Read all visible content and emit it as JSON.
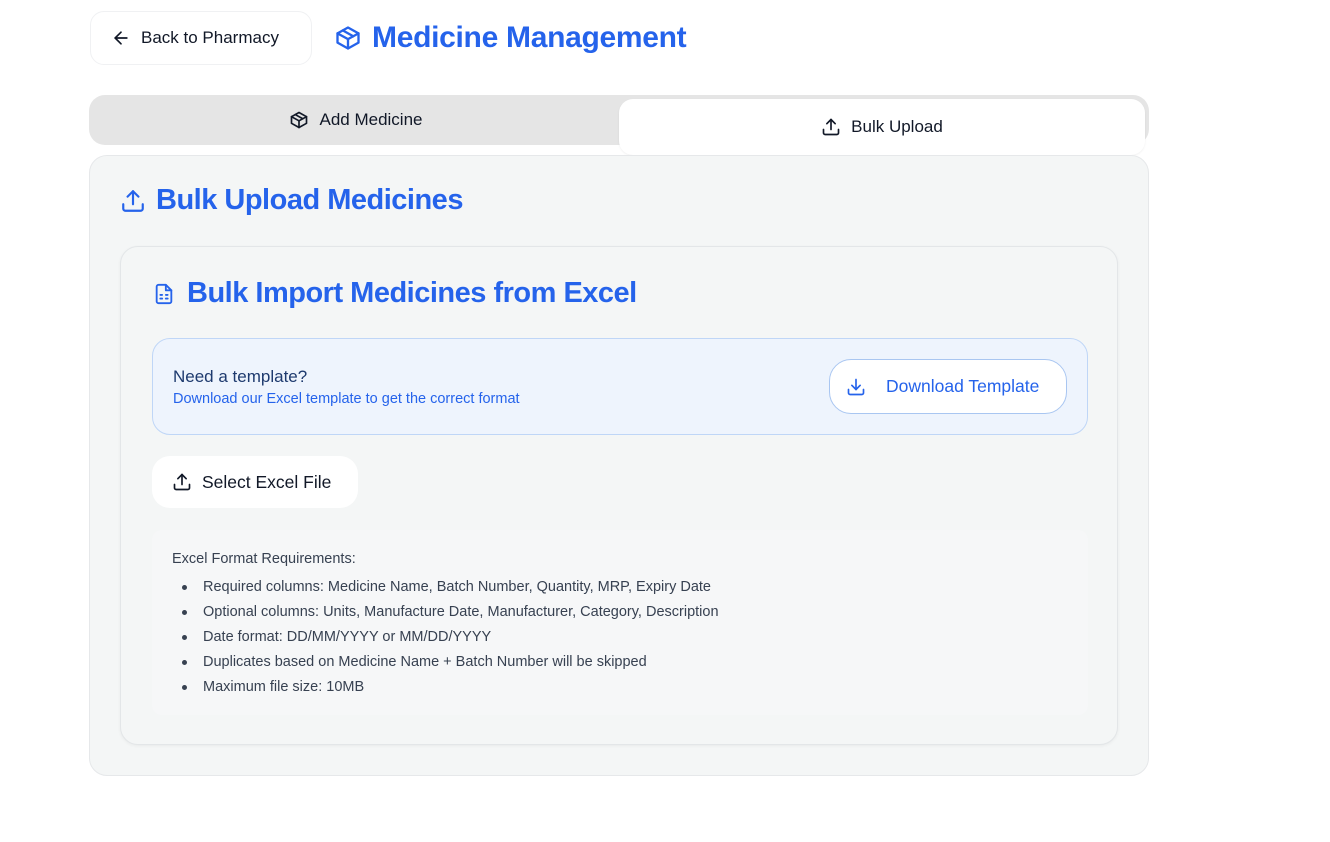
{
  "header": {
    "back_label": "Back to Pharmacy",
    "title": "Medicine Management",
    "icons": {
      "back": "arrow-left-icon",
      "title": "package-icon"
    }
  },
  "tabs": [
    {
      "label": "Add Medicine",
      "icon": "package-icon",
      "active": false
    },
    {
      "label": "Bulk Upload",
      "icon": "upload-icon",
      "active": true
    }
  ],
  "card": {
    "title": "Bulk Upload Medicines",
    "icon": "upload-icon"
  },
  "import": {
    "title": "Bulk Import Medicines from Excel",
    "icon": "file-spreadsheet-icon",
    "template": {
      "heading": "Need a template?",
      "subtext": "Download our Excel template to get the correct format",
      "button_label": "Download Template",
      "button_icon": "download-icon"
    },
    "select_file": {
      "label": "Select Excel File",
      "icon": "upload-icon"
    },
    "requirements": {
      "title": "Excel Format Requirements:",
      "items": [
        "Required columns: Medicine Name, Batch Number, Quantity, MRP, Expiry Date",
        "Optional columns: Units, Manufacture Date, Manufacturer, Category, Description",
        "Date format: DD/MM/YYYY or MM/DD/YYYY",
        "Duplicates based on Medicine Name + Batch Number will be skipped",
        "Maximum file size: 10MB"
      ]
    }
  },
  "colors": {
    "accent": "#2563eb",
    "tab_bg": "#e5e5e5",
    "card_bg": "#f4f6f6",
    "template_bg": "#eef4fd",
    "template_border": "#bfd6f7"
  }
}
